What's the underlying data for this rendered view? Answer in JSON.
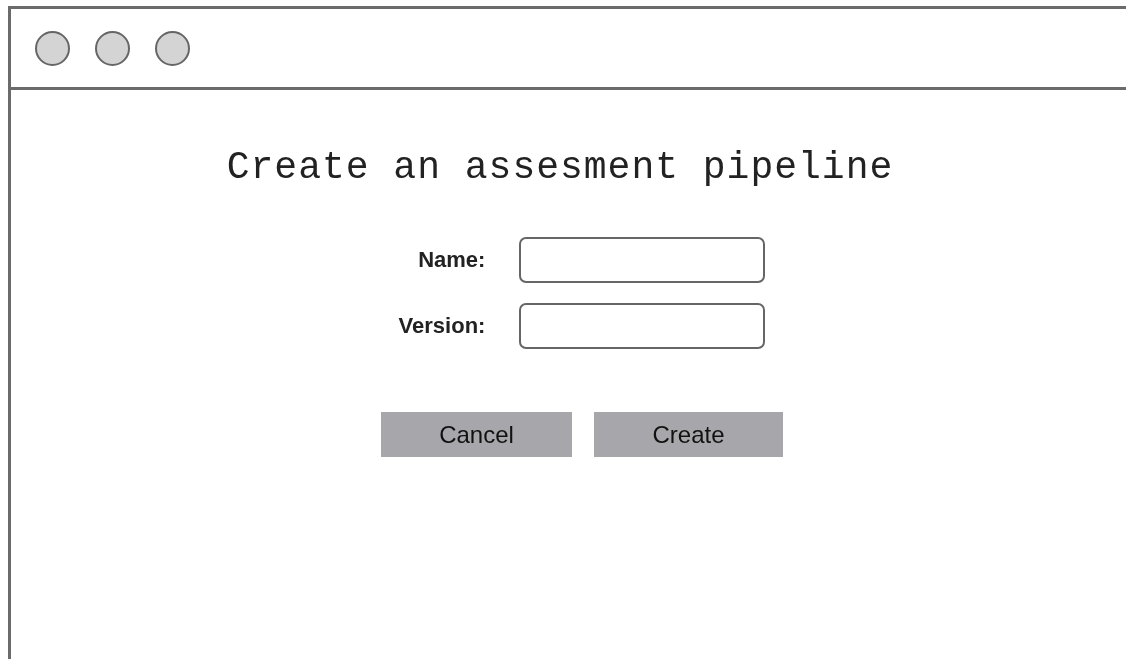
{
  "title": "Create an assesment pipeline",
  "form": {
    "fields": [
      {
        "label": "Name:"
      },
      {
        "label": "Version:"
      }
    ]
  },
  "buttons": [
    {
      "label": "Cancel"
    },
    {
      "label": "Create"
    }
  ]
}
